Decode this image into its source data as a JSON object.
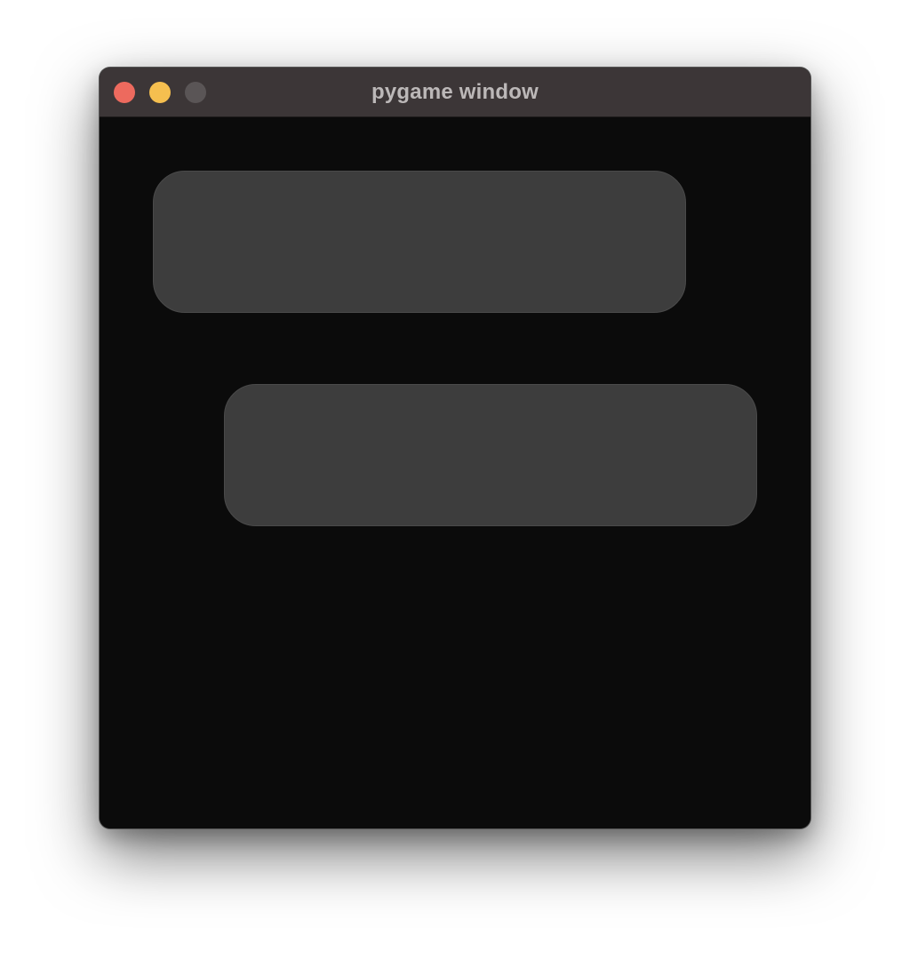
{
  "window": {
    "title": "pygame window"
  },
  "colors": {
    "close": "#ed6a5e",
    "minimize": "#f5bf4f",
    "zoom_disabled": "#5a5556",
    "titlebar": "#3c3637",
    "background": "#0b0b0b",
    "block": "#3d3d3d"
  },
  "icons": {
    "close": "close-circle-icon",
    "minimize": "minimize-circle-icon",
    "zoom": "zoom-circle-icon"
  }
}
